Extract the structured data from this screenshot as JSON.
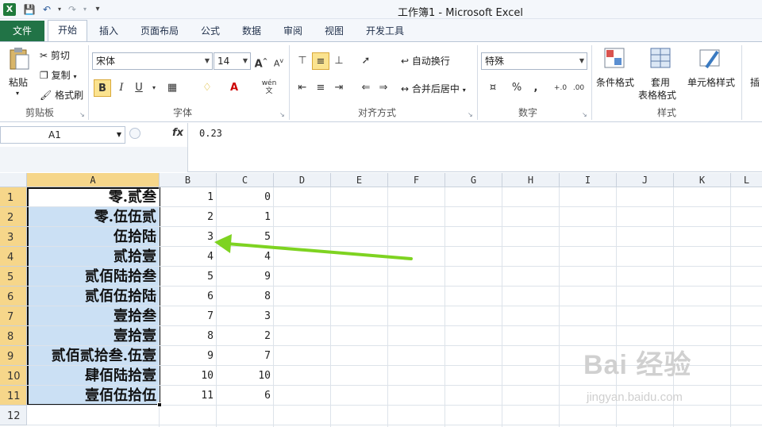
{
  "window": {
    "title": "工作簿1 - Microsoft Excel",
    "app_icon": "X"
  },
  "tabs": [
    "文件",
    "开始",
    "插入",
    "页面布局",
    "公式",
    "数据",
    "审阅",
    "视图",
    "开发工具"
  ],
  "ribbon": {
    "clipboard": {
      "paste": "粘贴",
      "cut": "剪切",
      "copy": "复制",
      "format_painter": "格式刷",
      "label": "剪贴板"
    },
    "font": {
      "name": "宋体",
      "size": "14",
      "bold": "B",
      "italic": "I",
      "underline": "U",
      "label": "字体",
      "wen": "wén",
      "wen_char": "文"
    },
    "alignment": {
      "wrap": "自动换行",
      "merge": "合并后居中",
      "label": "对齐方式"
    },
    "number": {
      "format": "特殊",
      "percent": "%",
      "comma": ",",
      "label": "数字"
    },
    "styles": {
      "conditional": "条件格式",
      "table1": "套用",
      "table2": "表格格式",
      "cell_styles": "单元格样式",
      "label": "样式"
    },
    "insert_partial": "插"
  },
  "formula_bar": {
    "name_box": "A1",
    "fx": "fx",
    "content": "0.23"
  },
  "columns": [
    "A",
    "B",
    "C",
    "D",
    "E",
    "F",
    "G",
    "H",
    "I",
    "J",
    "K",
    "L"
  ],
  "rows": [
    {
      "num": "1",
      "a": "零.贰叁",
      "b": "1",
      "c": "0"
    },
    {
      "num": "2",
      "a": "零.伍伍贰",
      "b": "2",
      "c": "1"
    },
    {
      "num": "3",
      "a": "伍拾陆",
      "b": "3",
      "c": "5"
    },
    {
      "num": "4",
      "a": "贰拾壹",
      "b": "4",
      "c": "4"
    },
    {
      "num": "5",
      "a": "贰佰陆拾叁",
      "b": "5",
      "c": "9"
    },
    {
      "num": "6",
      "a": "贰佰伍拾陆",
      "b": "6",
      "c": "8"
    },
    {
      "num": "7",
      "a": "壹拾叁",
      "b": "7",
      "c": "3"
    },
    {
      "num": "8",
      "a": "壹拾壹",
      "b": "8",
      "c": "2"
    },
    {
      "num": "9",
      "a": "贰佰贰拾叁.伍壹",
      "b": "9",
      "c": "7"
    },
    {
      "num": "10",
      "a": "肆佰陆拾壹",
      "b": "10",
      "c": "10"
    },
    {
      "num": "11",
      "a": "壹佰伍拾伍",
      "b": "11",
      "c": "6"
    },
    {
      "num": "12",
      "a": "",
      "b": "",
      "c": ""
    }
  ],
  "watermark": {
    "brand": "Bai 经验",
    "url": "jingyan.baidu.com"
  },
  "colors": {
    "file_tab": "#217346",
    "selection": "#cbe0f4",
    "arrow": "#7ed321"
  }
}
